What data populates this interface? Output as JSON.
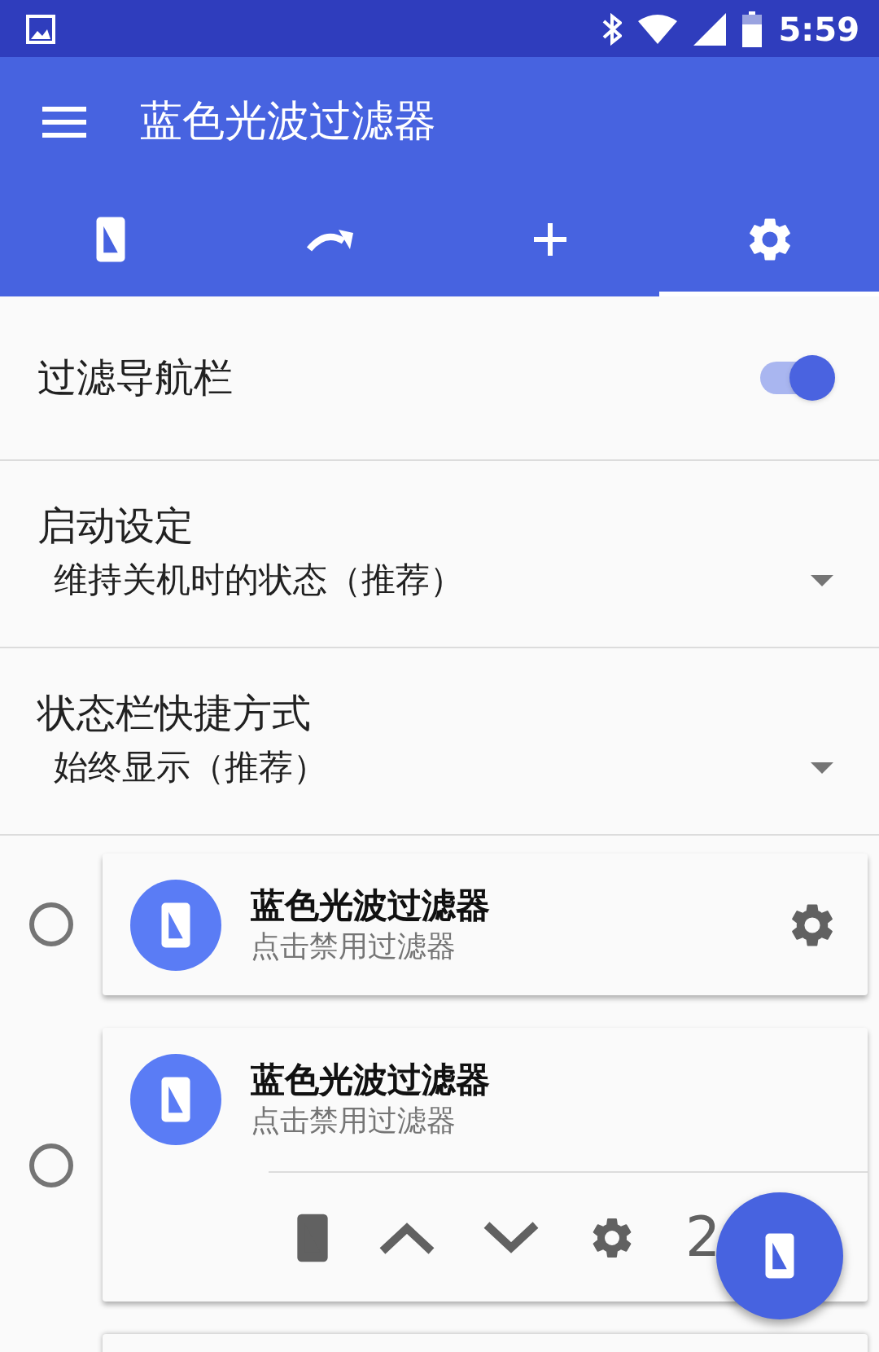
{
  "status_bar": {
    "time": "5:59"
  },
  "app_bar": {
    "title": "蓝色光波过滤器"
  },
  "tabs": [
    {
      "kind": "phone",
      "selected": false
    },
    {
      "kind": "redo",
      "selected": false
    },
    {
      "kind": "add",
      "selected": false
    },
    {
      "kind": "settings",
      "selected": true
    }
  ],
  "settings": [
    {
      "kind": "switch",
      "label": "过滤导航栏",
      "on": true
    },
    {
      "kind": "dropdown",
      "label": "启动设定",
      "value": "维持关机时的状态（推荐）"
    },
    {
      "kind": "dropdown",
      "label": "状态栏快捷方式",
      "value": "始终显示（推荐）"
    }
  ],
  "filters": [
    {
      "title": "蓝色光波过滤器",
      "subtitle": "点击禁用过滤器",
      "selected": false,
      "expanded": false
    },
    {
      "title": "蓝色光波过滤器",
      "subtitle": "点击禁用过滤器",
      "selected": false,
      "expanded": true,
      "extra": "2"
    }
  ]
}
